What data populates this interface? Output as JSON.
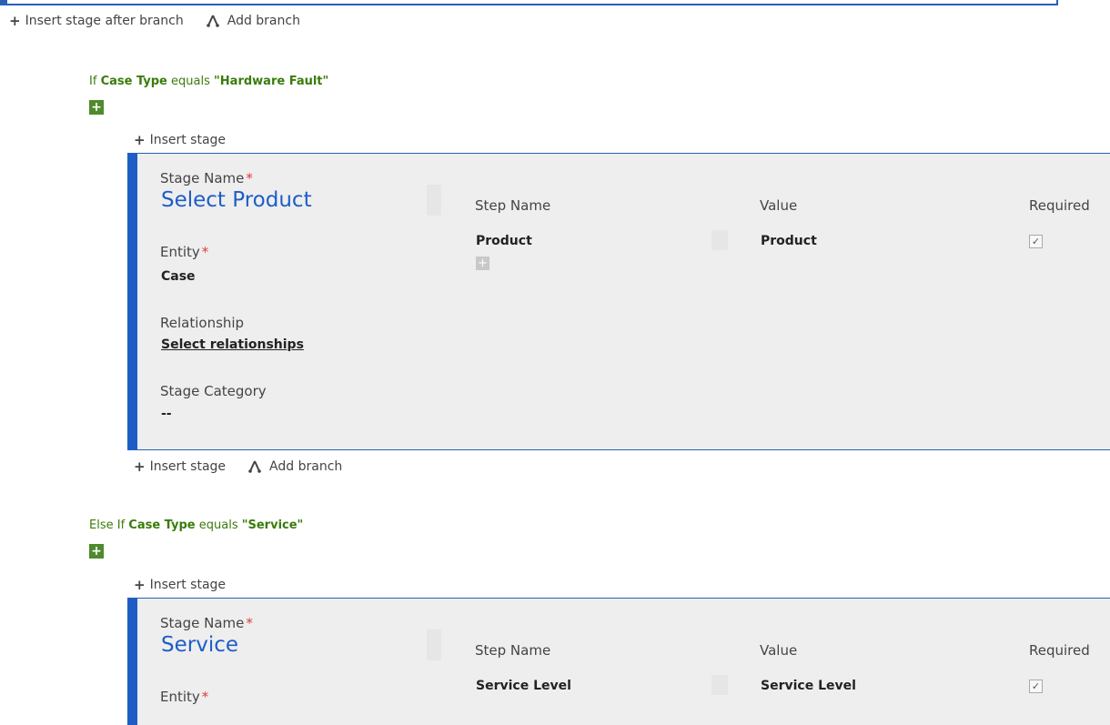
{
  "top_actions": {
    "insert_stage_after_branch": "Insert stage after branch",
    "add_branch": "Add branch"
  },
  "branches": [
    {
      "condition": {
        "prefix": "If",
        "field": "Case Type",
        "operator": "equals",
        "value": "\"Hardware Fault\""
      },
      "insert_stage_label": "Insert stage",
      "stage": {
        "stage_name_label": "Stage Name",
        "stage_name": "Select Product",
        "entity_label": "Entity",
        "entity": "Case",
        "relationship_label": "Relationship",
        "relationship_link": "Select relationships",
        "category_label": "Stage Category",
        "category": "--",
        "columns": {
          "step_name": "Step Name",
          "value": "Value",
          "required": "Required"
        },
        "steps": [
          {
            "name": "Product",
            "value": "Product",
            "required": true
          }
        ]
      },
      "after_actions": {
        "insert_stage": "Insert stage",
        "add_branch": "Add branch"
      }
    },
    {
      "condition": {
        "prefix": "Else If",
        "field": "Case Type",
        "operator": "equals",
        "value": "\"Service\""
      },
      "insert_stage_label": "Insert stage",
      "stage": {
        "stage_name_label": "Stage Name",
        "stage_name": "Service",
        "entity_label": "Entity",
        "columns": {
          "step_name": "Step Name",
          "value": "Value",
          "required": "Required"
        },
        "steps": [
          {
            "name": "Service Level",
            "value": "Service Level",
            "required": true
          }
        ]
      }
    }
  ],
  "icons": {
    "plus": "plus-icon",
    "branch": "branch-icon",
    "green_add": "add-condition-icon",
    "checkbox": "checkbox-checked-icon"
  },
  "colors": {
    "stage_accent": "#1e5dc6",
    "stage_bg": "#eeeeee",
    "condition_green": "#3a7c0b",
    "green_button": "#4f8a2c",
    "required_star": "#e03b3b"
  }
}
